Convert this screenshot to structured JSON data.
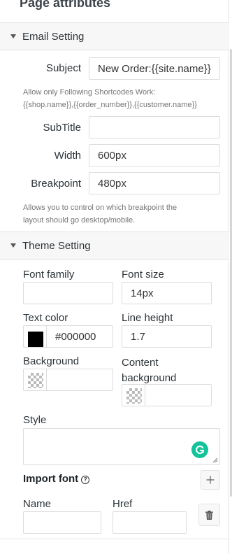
{
  "page_title": "Page attributes",
  "email_setting": {
    "title": "Email Setting",
    "subject_label": "Subject",
    "subject_value": "New Order:{{site.name}}",
    "subject_help_line1": "Allow only Following Shortcodes Work:",
    "subject_help_line2": "{{shop.name}},{{order_number}},{{customer.name}}",
    "subtitle_label": "SubTitle",
    "subtitle_value": "",
    "width_label": "Width",
    "width_value": "600px",
    "breakpoint_label": "Breakpoint",
    "breakpoint_value": "480px",
    "breakpoint_help_line1": "Allows you to control on which breakpoint the",
    "breakpoint_help_line2": "layout should go desktop/mobile."
  },
  "theme_setting": {
    "title": "Theme Setting",
    "font_family_label": "Font family",
    "font_family_value": "",
    "font_size_label": "Font size",
    "font_size_value": "14px",
    "text_color_label": "Text color",
    "text_color_value": "#000000",
    "text_color_swatch": "#000000",
    "line_height_label": "Line height",
    "line_height_value": "1.7",
    "background_label": "Background",
    "background_value": "",
    "content_background_label_line1": "Content",
    "content_background_label_line2": "background",
    "content_background_value": "",
    "style_label": "Style",
    "style_value": ""
  },
  "import_font": {
    "title": "Import font",
    "help_glyph": "?",
    "name_label": "Name",
    "name_value": "",
    "href_label": "Href",
    "href_value": ""
  },
  "colors": {
    "grammarly": "#15c39a",
    "section_bg": "#f7f7f7"
  },
  "icons": [
    "caret-down-icon",
    "help-icon",
    "grammarly-icon",
    "plus-icon",
    "trash-icon"
  ]
}
